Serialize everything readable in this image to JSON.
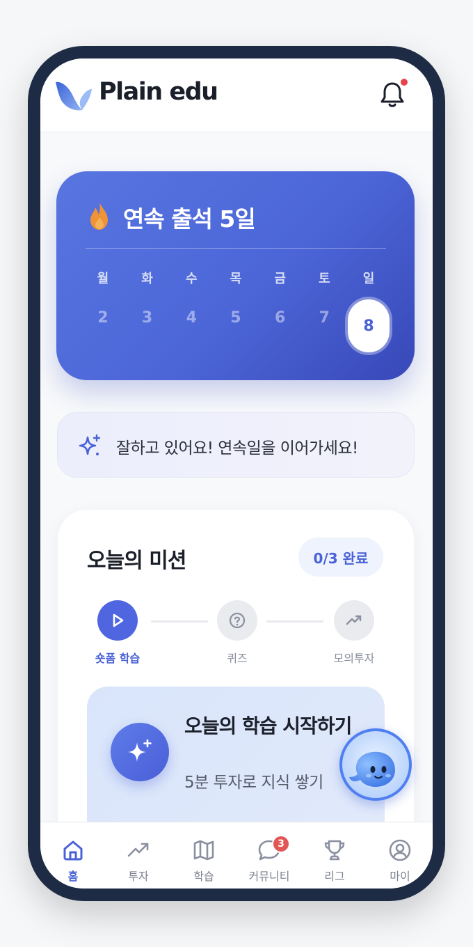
{
  "header": {
    "brand": "Plain edu",
    "logo_icon": "whale-tail-logo-icon",
    "notification_icon": "bell-icon",
    "has_notification": true
  },
  "streak": {
    "title": "연속 출석 5일",
    "icon": "flame-icon",
    "days": [
      {
        "name": "월",
        "num": "2"
      },
      {
        "name": "화",
        "num": "3"
      },
      {
        "name": "수",
        "num": "4"
      },
      {
        "name": "목",
        "num": "5"
      },
      {
        "name": "금",
        "num": "6"
      },
      {
        "name": "토",
        "num": "7"
      },
      {
        "name": "일",
        "num": "8",
        "today": true
      }
    ]
  },
  "cheer": {
    "icon": "sparkle-icon",
    "text": "잘하고 있어요! 연속일을 이어가세요!"
  },
  "mission": {
    "title": "오늘의 미션",
    "progress": "0/3 완료",
    "steps": [
      {
        "label": "숏폼 학습",
        "icon": "play-icon",
        "active": true
      },
      {
        "label": "퀴즈",
        "icon": "question-icon",
        "active": false
      },
      {
        "label": "모의투자",
        "icon": "trend-up-icon",
        "active": false
      }
    ],
    "start": {
      "title": "오늘의 학습 시작하기",
      "subtitle": "5분 투자로 지식 쌓기",
      "icon": "sparkle-icon"
    }
  },
  "mascot": {
    "icon": "whale-mascot-icon"
  },
  "tabbar": {
    "items": [
      {
        "label": "홈",
        "icon": "home-icon",
        "active": true
      },
      {
        "label": "투자",
        "icon": "trend-up-icon"
      },
      {
        "label": "학습",
        "icon": "map-icon"
      },
      {
        "label": "커뮤니티",
        "icon": "chat-icon",
        "badge": "3"
      },
      {
        "label": "리그",
        "icon": "trophy-icon"
      },
      {
        "label": "마이",
        "icon": "user-circle-icon"
      }
    ]
  },
  "colors": {
    "accent": "#4a62d6",
    "streak_from": "#5875e0",
    "streak_to": "#3848b8",
    "badge": "#e25656",
    "frame": "#1e2b45"
  }
}
